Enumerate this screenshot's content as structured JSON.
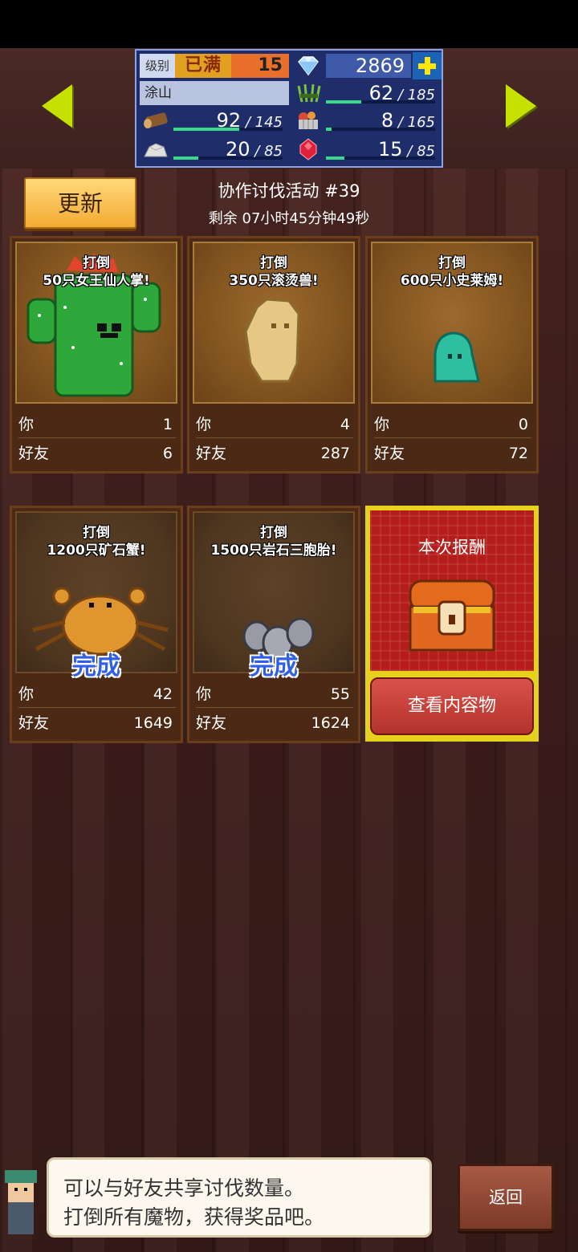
{
  "hud": {
    "level_label": "级别",
    "level_max": "已满",
    "level": "15",
    "gems": "2869",
    "player_name": "涂山",
    "resources": [
      {
        "icon": "wood-log-icon",
        "value": "92",
        "max": "145",
        "fill": 0.63
      },
      {
        "icon": "grass-bundle-icon",
        "value": "62",
        "max": "185",
        "fill": 0.34
      },
      {
        "icon": "food-basket-icon",
        "value": "8",
        "max": "165",
        "fill": 0.05
      },
      {
        "icon": "stone-ore-icon",
        "value": "20",
        "max": "85",
        "fill": 0.24
      },
      {
        "icon": "red-gem-icon",
        "value": "15",
        "max": "85",
        "fill": 0.18
      }
    ]
  },
  "event": {
    "refresh_label": "更新",
    "title": "协作讨伐活动 #39",
    "time_left": "剩余 07小时45分钟49秒"
  },
  "quests": [
    {
      "task_line1": "打倒",
      "task_line2": "50只女王仙人掌!",
      "you_label": "你",
      "you": "1",
      "friends_label": "好友",
      "friends": "6",
      "status": ""
    },
    {
      "task_line1": "打倒",
      "task_line2": "350只滚烫兽!",
      "you_label": "你",
      "you": "4",
      "friends_label": "好友",
      "friends": "287",
      "status": ""
    },
    {
      "task_line1": "打倒",
      "task_line2": "600只小史莱姆!",
      "you_label": "你",
      "you": "0",
      "friends_label": "好友",
      "friends": "72",
      "status": ""
    },
    {
      "task_line1": "打倒",
      "task_line2": "1200只矿石蟹!",
      "you_label": "你",
      "you": "42",
      "friends_label": "好友",
      "friends": "1649",
      "status": "完成"
    },
    {
      "task_line1": "打倒",
      "task_line2": "1500只岩石三胞胎!",
      "you_label": "你",
      "you": "55",
      "friends_label": "好友",
      "friends": "1624",
      "status": "完成"
    }
  ],
  "reward": {
    "title": "本次报酬",
    "button": "查看内容物"
  },
  "dialog": {
    "line1": "可以与好友共享讨伐数量。",
    "line2": "打倒所有魔物，获得奖品吧。"
  },
  "back_label": "返回"
}
